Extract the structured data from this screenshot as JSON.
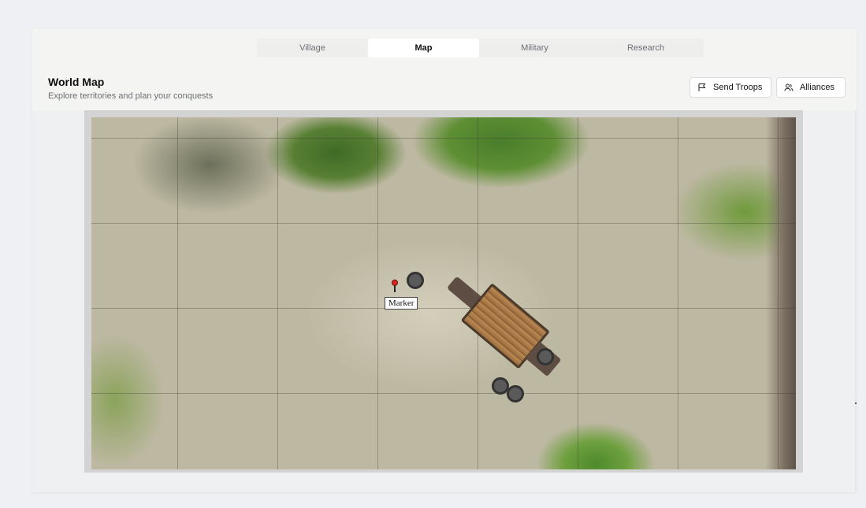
{
  "tabs": [
    {
      "label": "Village",
      "active": false
    },
    {
      "label": "Map",
      "active": true
    },
    {
      "label": "Military",
      "active": false
    },
    {
      "label": "Research",
      "active": false
    }
  ],
  "header": {
    "title": "World Map",
    "subtitle": "Explore territories and plan your conquests"
  },
  "actions": {
    "send_troops": {
      "label": "Send Troops",
      "icon": "flag-icon"
    },
    "alliances": {
      "label": "Alliances",
      "icon": "users-icon"
    }
  },
  "map": {
    "marker_label": "Marker"
  },
  "colors": {
    "accent_bg": "#f4f4f2",
    "tab_active": "#ffffff",
    "marker_pin": "#d9261c"
  }
}
